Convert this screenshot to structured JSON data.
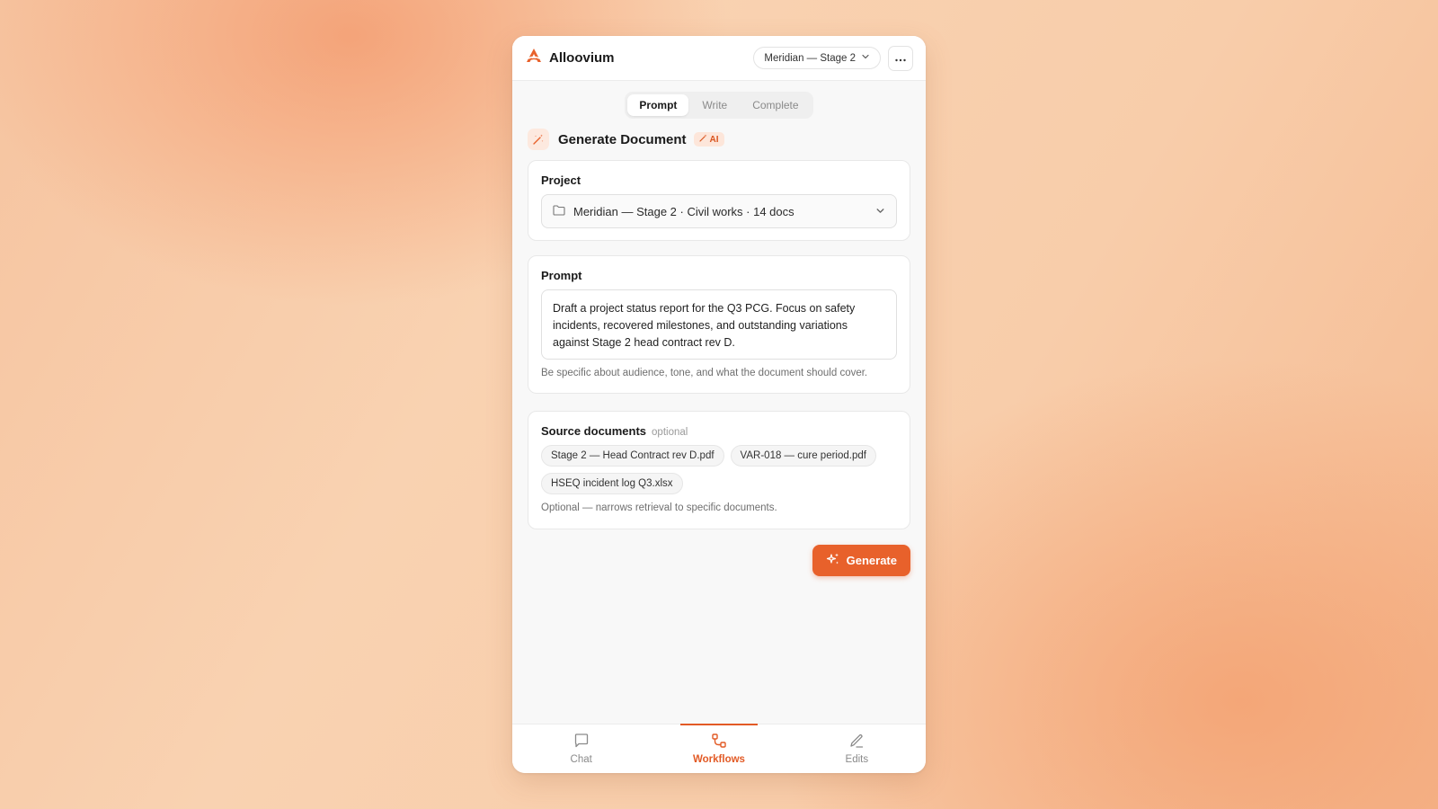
{
  "app": {
    "name": "Alloovium"
  },
  "header": {
    "project_selector": "Meridian — Stage 2"
  },
  "tabs": [
    {
      "label": "Prompt",
      "active": true
    },
    {
      "label": "Write",
      "active": false
    },
    {
      "label": "Complete",
      "active": false
    }
  ],
  "page": {
    "title": "Generate Document",
    "badge": "AI"
  },
  "project": {
    "label": "Project",
    "value": "Meridian — Stage 2 · Civil works · 14 docs"
  },
  "prompt": {
    "label": "Prompt",
    "value": "Draft a project status report for the Q3 PCG. Focus on safety incidents, recovered milestones, and outstanding variations against Stage 2 head contract rev D.",
    "hint": "Be specific about audience, tone, and what the document should cover."
  },
  "sources": {
    "label": "Source documents",
    "optional_tag": "optional",
    "chips": [
      "Stage 2 — Head Contract rev D.pdf",
      "VAR-018 — cure period.pdf",
      "HSEQ incident log Q3.xlsx"
    ],
    "hint": "Optional — narrows retrieval to specific documents."
  },
  "actions": {
    "generate": "Generate"
  },
  "nav": [
    {
      "label": "Chat",
      "icon": "chat-icon",
      "active": false
    },
    {
      "label": "Workflows",
      "icon": "workflows-icon",
      "active": true
    },
    {
      "label": "Edits",
      "icon": "pencil-icon",
      "active": false
    }
  ],
  "colors": {
    "accent": "#e8612b",
    "badge_bg": "#fde6da"
  }
}
